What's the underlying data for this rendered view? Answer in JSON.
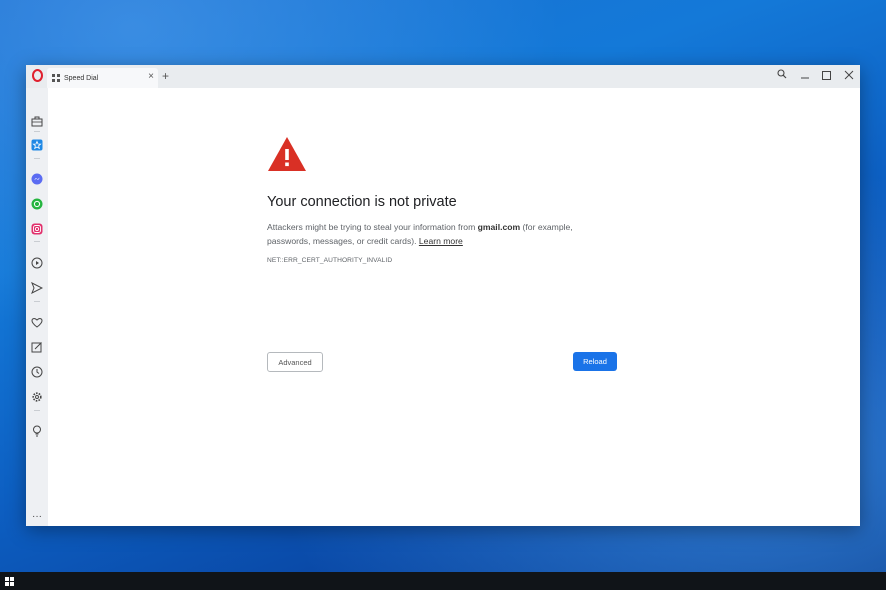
{
  "tab": {
    "title": "Speed Dial",
    "close_glyph": "×",
    "new_tab_glyph": "+"
  },
  "sidebar": {
    "items": [
      {
        "name": "workspaces-icon"
      },
      {
        "name": "speed-dial-icon"
      },
      {
        "name": "messenger-icon"
      },
      {
        "name": "whatsapp-icon"
      },
      {
        "name": "instagram-icon"
      },
      {
        "name": "player-icon"
      },
      {
        "name": "my-flow-icon"
      },
      {
        "name": "bookmarks-icon"
      },
      {
        "name": "pinboard-icon"
      },
      {
        "name": "history-icon"
      },
      {
        "name": "settings-icon"
      },
      {
        "name": "lightbulb-icon"
      }
    ],
    "more_glyph": "···"
  },
  "error_page": {
    "heading": "Your connection is not private",
    "message_prefix": "Attackers might be trying to steal your information from ",
    "domain": "gmail.com",
    "message_suffix": " (for example, passwords, messages, or credit cards). ",
    "learn_more": "Learn more",
    "error_code": "NET::ERR_CERT_AUTHORITY_INVALID",
    "advanced_label": "Advanced",
    "reload_label": "Reload"
  },
  "colors": {
    "warning": "#d93025",
    "reload_button": "#1a73e8",
    "opera_red": "#e0202e"
  }
}
